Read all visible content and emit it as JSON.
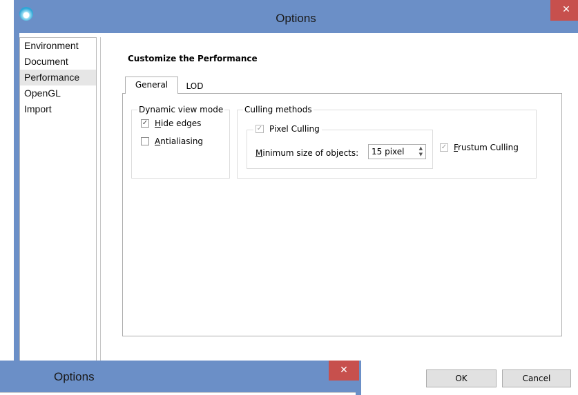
{
  "window": {
    "title": "Options",
    "close_label": "✕"
  },
  "nav": {
    "items": [
      "Environment",
      "Document",
      "Performance",
      "OpenGL",
      "Import"
    ],
    "selected": "Performance"
  },
  "content": {
    "heading": "Customize the Performance"
  },
  "tabs": [
    {
      "label": "General",
      "active": true
    },
    {
      "label": "LOD",
      "active": false
    }
  ],
  "dynamic_view": {
    "legend": "Dynamic view mode",
    "hide_edges": {
      "label_prefix": "",
      "accel": "H",
      "label_rest": "ide edges",
      "checked": true
    },
    "antialiasing": {
      "accel": "A",
      "label_rest": "ntialiasing",
      "checked": false
    }
  },
  "culling": {
    "legend": "Culling methods",
    "pixel": {
      "label": "Pixel Culling",
      "checked": true,
      "enabled": false
    },
    "min_size": {
      "accel": "M",
      "label_rest": "inimum size of objects:",
      "value": "15 pixel"
    },
    "frustum": {
      "accel": "F",
      "label_rest": "rustum Culling",
      "checked": true,
      "enabled": false
    }
  },
  "buttons": {
    "ok": "OK",
    "cancel": "Cancel"
  },
  "window2": {
    "title": "Options",
    "close_label": "✕"
  },
  "colors": {
    "titlebar": "#6b8fc7",
    "close": "#c7504d"
  }
}
